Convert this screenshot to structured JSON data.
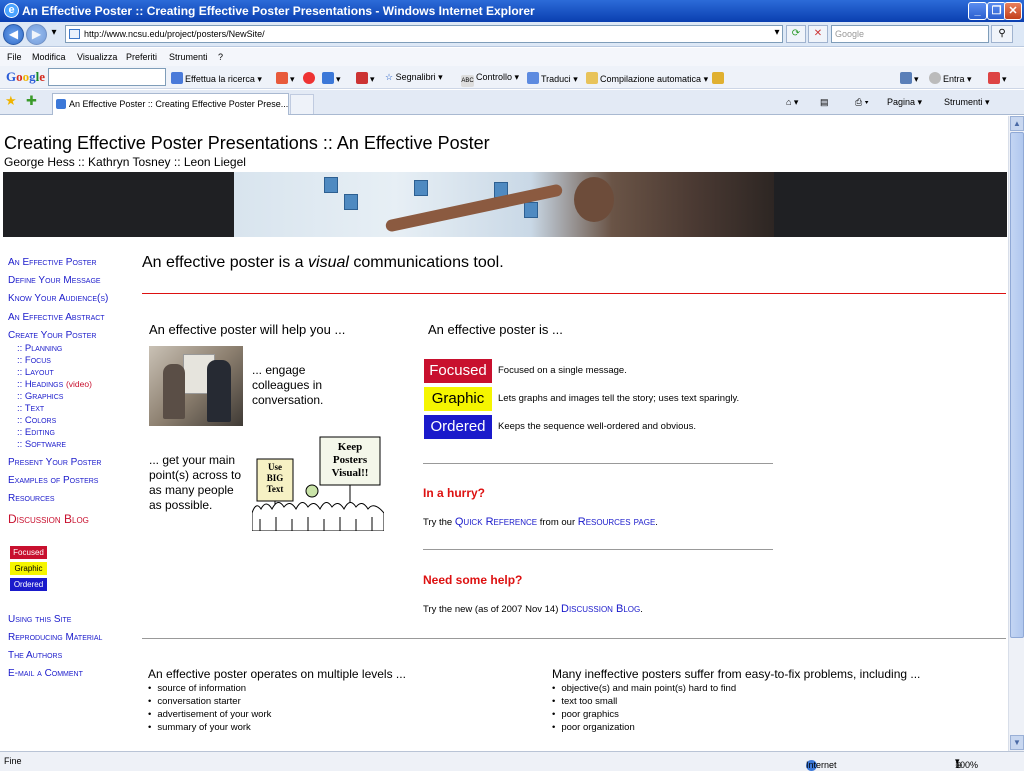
{
  "window": {
    "title": "An Effective Poster :: Creating Effective Poster Presentations - Windows Internet Explorer"
  },
  "address": {
    "url": "http://www.ncsu.edu/project/posters/NewSite/",
    "search_placeholder": "Google"
  },
  "menu": [
    "File",
    "Modifica",
    "Visualizza",
    "Preferiti",
    "Strumenti",
    "?"
  ],
  "google_toolbar": {
    "logo": "Google",
    "search_label": "Effettua la ricerca",
    "bookmarks": "Segnalibri",
    "check": "Controllo",
    "translate": "Traduci",
    "autofill": "Compilazione automatica",
    "signin": "Entra"
  },
  "tabs": {
    "active_title": "An Effective Poster :: Creating Effective Poster Prese...",
    "page_menu": "Pagina",
    "tools_menu": "Strumenti"
  },
  "page": {
    "title": "Creating Effective Poster Presentations :: An Effective Poster",
    "authors": "George Hess :: Kathryn Tosney :: Leon Liegel",
    "tagline_pre": "An effective poster is a ",
    "tagline_em": "visual",
    "tagline_post": " communications tool.",
    "nav": [
      "An Effective Poster",
      "Define Your Message",
      "Know Your Audience(s)",
      "An Effective Abstract",
      "Create Your Poster"
    ],
    "subnav": [
      ":: Planning",
      ":: Focus",
      ":: Layout",
      ":: Headings",
      ":: Graphics",
      ":: Text",
      ":: Colors",
      ":: Editing",
      ":: Software"
    ],
    "headings_video": "(video)",
    "nav2": [
      "Present Your Poster",
      "Examples of Posters",
      "Resources"
    ],
    "discussion_blog": "Discussion Blog",
    "side_badges": [
      "Focused",
      "Graphic",
      "Ordered"
    ],
    "nav3": [
      "Using this Site",
      "Reproducing Material",
      "The Authors",
      "E-mail a Comment"
    ],
    "help_heading": "An effective poster will help you ...",
    "help_engage": "... engage colleagues in conversation.",
    "help_points": "... get your main point(s) across to as many people as possible.",
    "cartoon_sign1": "Keep Posters Visual!!",
    "cartoon_sign2": "Use BIG Text",
    "is_heading": "An effective poster is ...",
    "qualities": [
      {
        "label": "Focused",
        "desc": "Focused on a single message.",
        "bg": "#c8102e",
        "fg": "#ffffff"
      },
      {
        "label": "Graphic",
        "desc": "Lets graphs and images tell the story; uses text sparingly.",
        "bg": "#f5f500",
        "fg": "#000000"
      },
      {
        "label": "Ordered",
        "desc": "Keeps the sequence well-ordered and obvious.",
        "bg": "#1a1acb",
        "fg": "#ffffff"
      }
    ],
    "hurry_heading": "In a hurry?",
    "hurry_pre": "Try the ",
    "hurry_link1": "Quick Reference",
    "hurry_mid": " from our ",
    "hurry_link2": "Resources page",
    "hurry_post": ".",
    "needhelp_heading": "Need some help?",
    "needhelp_pre": "Try the new (as of 2007 Nov 14) ",
    "needhelp_link": "Discussion Blog",
    "needhelp_post": ".",
    "levels_heading": "An effective poster operates on multiple levels ...",
    "levels": [
      "source of information",
      "conversation starter",
      "advertisement of your work",
      "summary of your work"
    ],
    "problems_heading": "Many ineffective posters suffer from easy-to-fix problems, including ...",
    "problems": [
      "objective(s) and main point(s) hard to find",
      "text too small",
      "poor graphics",
      "poor organization"
    ]
  },
  "status": {
    "left": "Fine",
    "zone": "Internet",
    "zoom": "100%"
  },
  "colors": {
    "accent_red": "#c8102e",
    "link_blue": "#1a1acb",
    "divider_red": "#d11"
  }
}
